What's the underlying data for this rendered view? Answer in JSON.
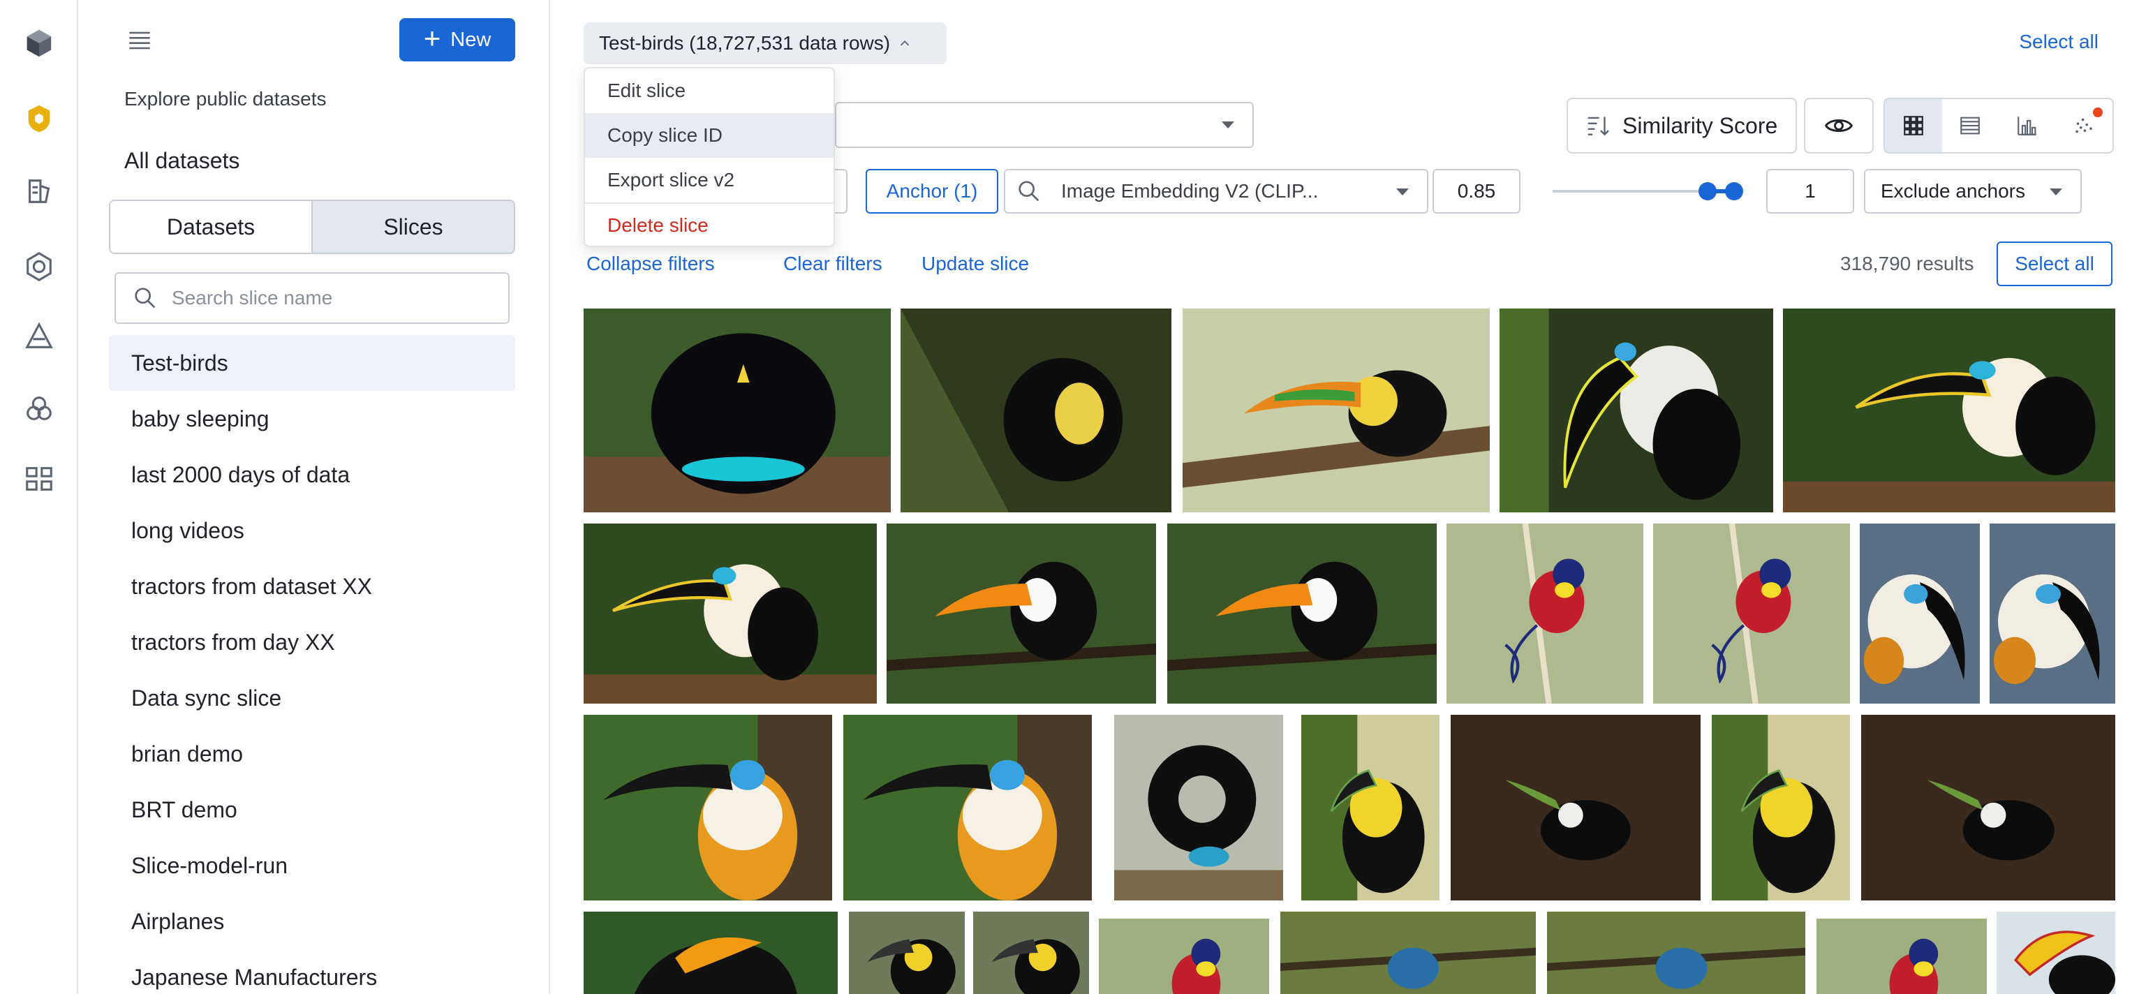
{
  "rail": {
    "icons": [
      "cube-icon",
      "shield-icon",
      "catalog-icon",
      "model-icon",
      "annotate-icon",
      "workflow-icon",
      "apps-icon"
    ],
    "accent": "#e8b10f"
  },
  "sidebar": {
    "new_label": "New",
    "explore_label": "Explore public datasets",
    "all_datasets_label": "All datasets",
    "tabs": [
      {
        "label": "Datasets",
        "active": false
      },
      {
        "label": "Slices",
        "active": true
      }
    ],
    "search_placeholder": "Search slice name",
    "slices": [
      "Test-birds",
      "baby sleeping",
      "last 2000 days of data",
      "long videos",
      "tractors from dataset XX",
      "tractors from day XX",
      "Data sync slice",
      "brian demo",
      "BRT demo",
      "Slice-model-run",
      "Airplanes",
      "Japanese Manufacturers"
    ],
    "selected_index": 0
  },
  "main": {
    "slice_title": "Test-birds (18,727,531 data rows)",
    "select_all_top": "Select all",
    "slice_menu": {
      "items": [
        "Edit slice",
        "Copy slice ID",
        "Export slice v2",
        "Delete slice"
      ],
      "hovered_index": 1
    },
    "sort_label": "Similarity Score",
    "anchor_label": "Anchor (1)",
    "embedding_label": "Image Embedding V2 (CLIP...",
    "threshold": "0.85",
    "slider_range": [
      0.83,
      0.97
    ],
    "count_value": "1",
    "exclude_label": "Exclude anchors",
    "links": [
      "Collapse filters",
      "Clear filters",
      "Update slice"
    ],
    "results": "318,790 results",
    "select_all_btn": "Select all",
    "primary_color": "#1a66d6",
    "danger_color": "#d22b1e"
  }
}
